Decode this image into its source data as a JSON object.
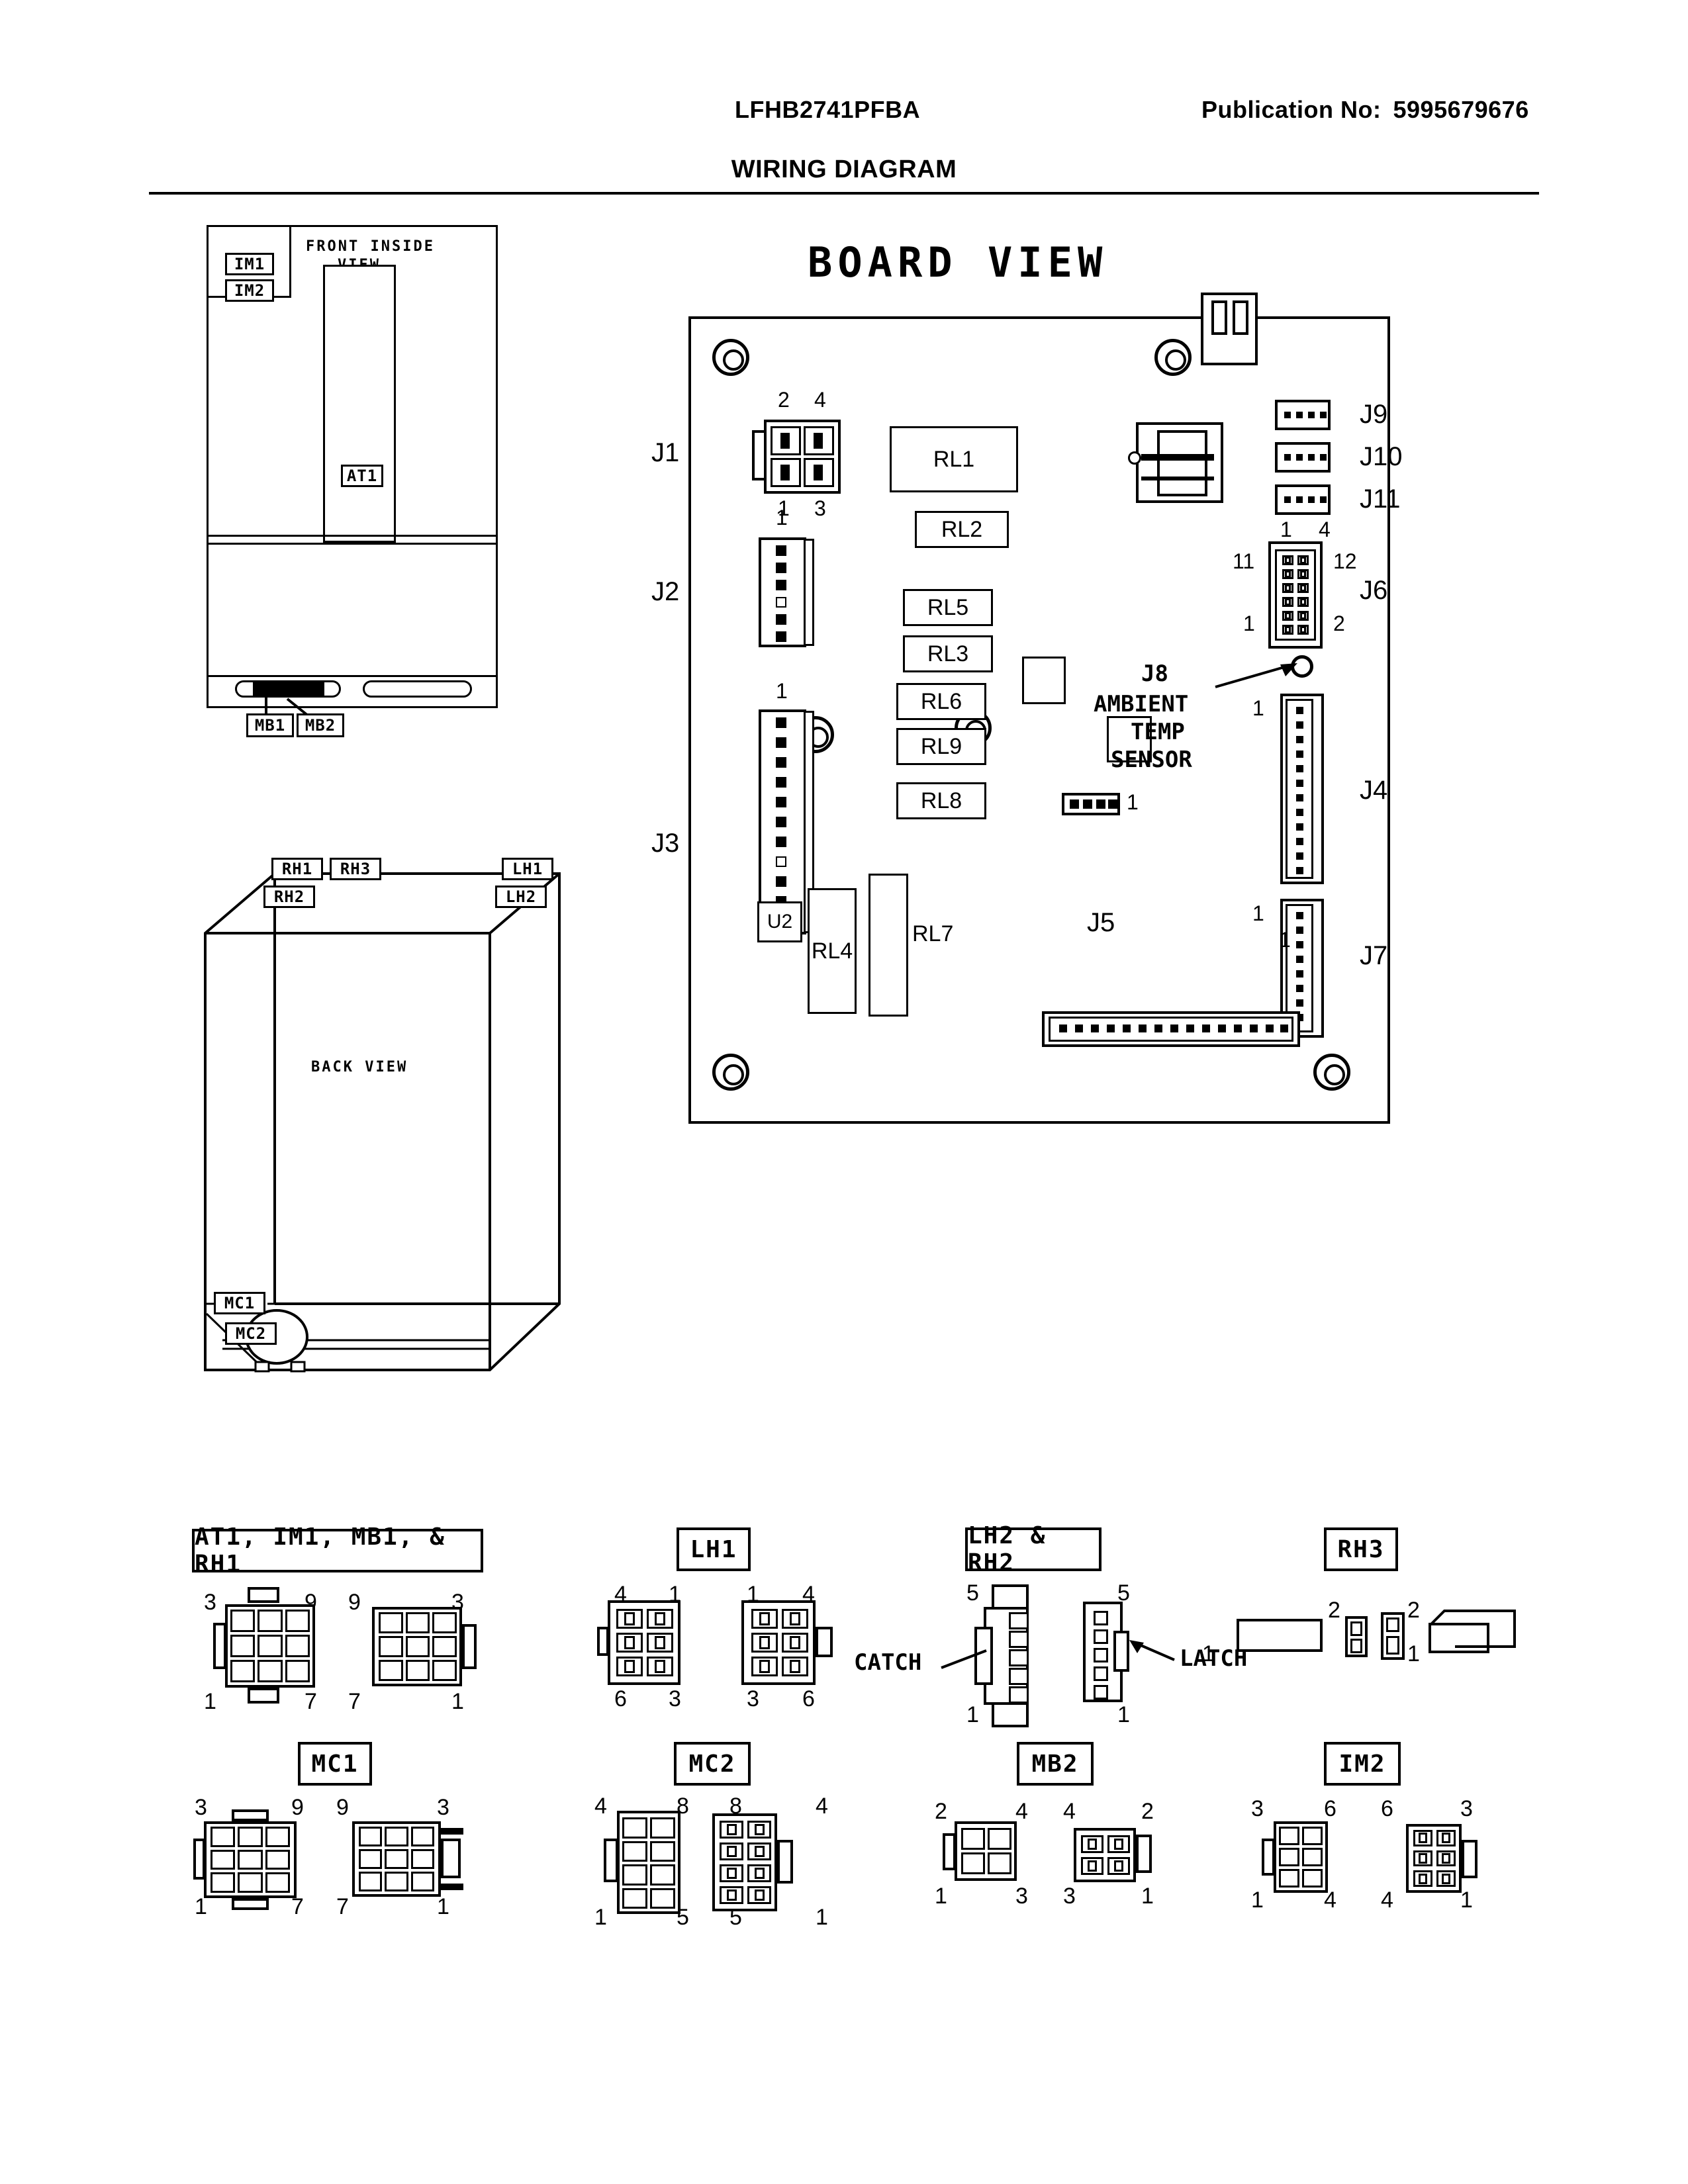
{
  "header": {
    "model": "LFHB2741PFBA",
    "publication_label": "Publication No:",
    "publication_number": "5995679676",
    "title": "WIRING DIAGRAM"
  },
  "front_view": {
    "title_line1": "FRONT INSIDE",
    "title_line2": "VIEW",
    "labels": {
      "im1": "IM1",
      "im2": "IM2",
      "at1": "AT1",
      "mb1": "MB1",
      "mb2": "MB2"
    }
  },
  "back_view": {
    "title": "BACK VIEW",
    "labels": {
      "rh1": "RH1",
      "rh2": "RH2",
      "rh3": "RH3",
      "lh1": "LH1",
      "lh2": "LH2",
      "mc1": "MC1",
      "mc2": "MC2"
    }
  },
  "board": {
    "title": "BOARD VIEW",
    "connectors": {
      "j1": {
        "label": "J1",
        "pins_top_left": "2",
        "pins_top_right": "4",
        "pins_bottom_left": "1",
        "pins_bottom_right": "3"
      },
      "j2": {
        "label": "J2",
        "pin1": "1"
      },
      "j3": {
        "label": "J3",
        "pin1": "1"
      },
      "j4": {
        "label": "J4",
        "pin1": "1"
      },
      "j5": {
        "label": "J5",
        "pin1": "1"
      },
      "j6": {
        "label": "J6",
        "pin11": "11",
        "pin12": "12",
        "pin1": "1",
        "pin2": "2"
      },
      "j7": {
        "label": "J7",
        "pin1": "1"
      },
      "j8": {
        "label": "J8",
        "desc_line1": "AMBIENT",
        "desc_line2": "TEMP",
        "desc_line3": "SENSOR"
      },
      "j9": {
        "label": "J9"
      },
      "j10": {
        "label": "J10"
      },
      "j11": {
        "label": "J11",
        "pin1": "1",
        "pin4": "4"
      },
      "small4": {
        "pin1": "1"
      }
    },
    "relays": [
      "RL1",
      "RL2",
      "RL5",
      "RL3",
      "RL6",
      "RL9",
      "RL8",
      "RL4",
      "RL7"
    ],
    "ic": "U2"
  },
  "connector_details": [
    {
      "id": "at1-group",
      "title": "AT1, IM1, MB1, & RH1",
      "left": {
        "top_left": "3",
        "top_right": "9",
        "bottom_left": "1",
        "bottom_right": "7"
      },
      "right": {
        "top_left": "9",
        "top_right": "3",
        "bottom_left": "7",
        "bottom_right": "1"
      }
    },
    {
      "id": "lh1",
      "title": "LH1",
      "left": {
        "top_left": "4",
        "top_right": "1",
        "bottom_left": "6",
        "bottom_right": "3"
      },
      "right": {
        "top_left": "1",
        "top_right": "4",
        "bottom_left": "3",
        "bottom_right": "6"
      }
    },
    {
      "id": "lh2-rh2",
      "title": "LH2 & RH2",
      "left": {
        "top": "5",
        "bottom": "1",
        "annotation": "CATCH"
      },
      "right": {
        "top": "5",
        "bottom": "1",
        "annotation": "LATCH"
      }
    },
    {
      "id": "rh3",
      "title": "RH3",
      "left": {
        "top": "2",
        "bottom": "1"
      },
      "right": {
        "top": "2",
        "bottom": "1"
      }
    },
    {
      "id": "mc1",
      "title": "MC1",
      "left": {
        "top_left": "3",
        "top_right": "9",
        "bottom_left": "1",
        "bottom_right": "7"
      },
      "right": {
        "top_left": "9",
        "top_right": "3",
        "bottom_left": "7",
        "bottom_right": "1"
      }
    },
    {
      "id": "mc2",
      "title": "MC2",
      "left": {
        "top_left": "4",
        "top_right": "8",
        "bottom_left": "1",
        "bottom_right": "5"
      },
      "right": {
        "top_left": "8",
        "top_right": "4",
        "bottom_left": "5",
        "bottom_right": "1"
      }
    },
    {
      "id": "mb2",
      "title": "MB2",
      "left": {
        "top_left": "2",
        "top_right": "4",
        "bottom_left": "1",
        "bottom_right": "3"
      },
      "right": {
        "top_left": "4",
        "top_right": "2",
        "bottom_left": "3",
        "bottom_right": "1"
      }
    },
    {
      "id": "im2",
      "title": "IM2",
      "left": {
        "top_left": "3",
        "top_right": "6",
        "bottom_left": "1",
        "bottom_right": "4"
      },
      "right": {
        "top_left": "6",
        "top_right": "3",
        "bottom_left": "4",
        "bottom_right": "1"
      }
    }
  ]
}
